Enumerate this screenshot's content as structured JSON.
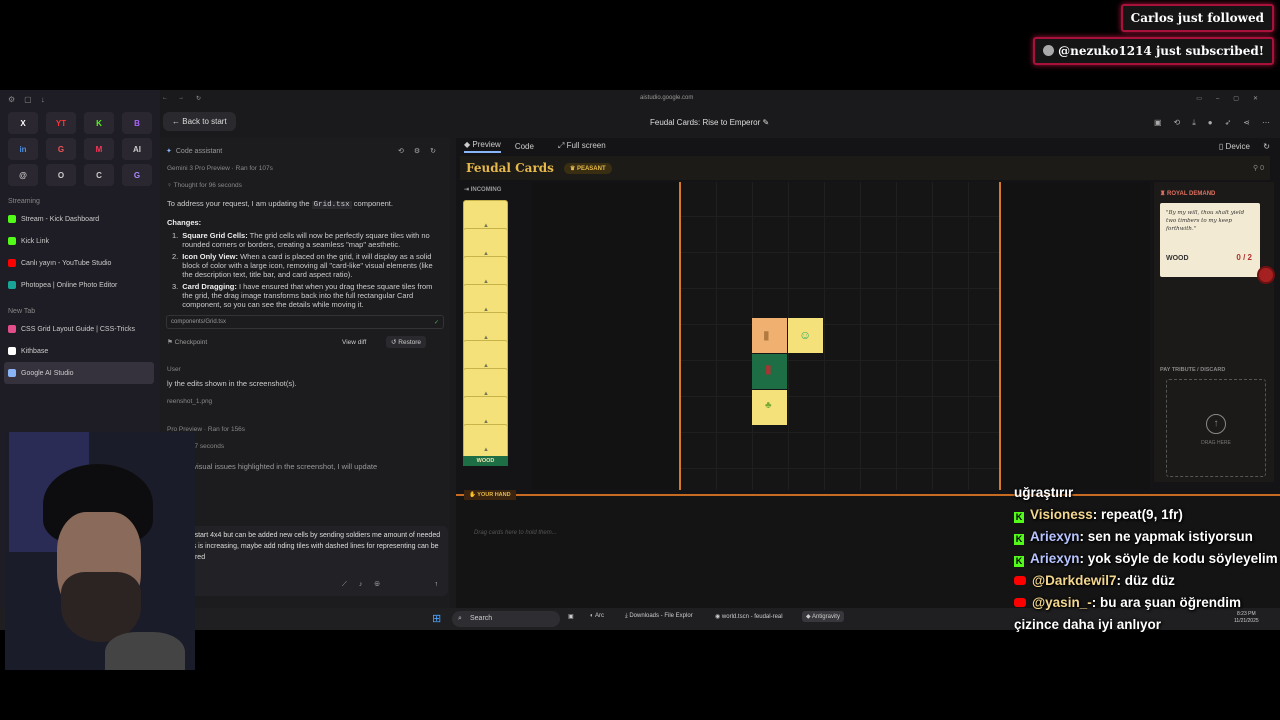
{
  "alerts": {
    "follow": "Carlos just followed",
    "subscribe": "@nezuko1214 just subscribed!"
  },
  "browser": {
    "url": "aistudio.google.com",
    "sidebar": {
      "pinned": [
        "X",
        "YT",
        "K",
        "B",
        "in",
        "G",
        "M",
        "AI",
        "@",
        "O",
        "C",
        "G"
      ],
      "section_streaming": "Streaming",
      "items": [
        {
          "label": "Stream - Kick Dashboard",
          "color": "#53fc18"
        },
        {
          "label": "Kick Link",
          "color": "#53fc18"
        },
        {
          "label": "Canlı yayın - YouTube Studio",
          "color": "#ff0000"
        },
        {
          "label": "Photopea | Online Photo Editor",
          "color": "#18a497"
        }
      ],
      "new_tab": "New Tab",
      "items2": [
        {
          "label": "CSS Grid Layout Guide | CSS-Tricks",
          "color": "#e24e8a"
        },
        {
          "label": "Kithbase",
          "color": "#ffffff"
        },
        {
          "label": "Google AI Studio",
          "color": "#8ab4f8"
        }
      ]
    }
  },
  "app": {
    "back_label": "Back to start",
    "title": "Feudal Cards: Rise to Emperor",
    "code_assistant": "Code assistant",
    "model": "Gemini 3 Pro Preview",
    "ran_for": "Ran for 107s",
    "thought": "Thought for 96 seconds",
    "intro_pre": "To address your request, I am updating the ",
    "intro_code": "Grid.tsx",
    "intro_post": " component.",
    "changes_heading": "Changes:",
    "changes": [
      {
        "n": "1.",
        "title": "Square Grid Cells:",
        "text": " The grid cells will now be perfectly square tiles with no rounded corners or borders, creating a seamless \"map\" aesthetic."
      },
      {
        "n": "2.",
        "title": "Icon Only View:",
        "text": " When a card is placed on the grid, it will display as a solid block of color with a large icon, removing all \"card-like\" visual elements (like the description text, title bar, and card aspect ratio)."
      },
      {
        "n": "3.",
        "title": "Card Dragging:",
        "text": " I have ensured that when you drag these square tiles from the grid, the drag image transforms back into the full rectangular Card component, so you can see the details while moving it."
      }
    ],
    "file": "components/Grid.tsx",
    "checkpoint": "Checkpoint",
    "view_diff": "View diff",
    "restore": "Restore",
    "user_label": "User",
    "user_msg": "ly the edits shown in the screenshot(s).",
    "attachment": "reenshot_1.png",
    "model2": "Pro Preview",
    "ran_for2": "Ran for 156s",
    "thought2": "ught for 97 seconds",
    "partial": "ess the visual issues highlighted in the screenshot, I will update",
    "input_text": "should start 4x4 but can be added new cells by sending soldiers me amount of needed soldiers is increasing, maybe add nding tiles with dashed lines for representing can be conquered"
  },
  "preview": {
    "tabs": [
      "Preview",
      "Code",
      "Full screen"
    ],
    "device": "Device",
    "game_title": "Feudal Cards",
    "rank": "PEASANT",
    "score": "0",
    "incoming": "INCOMING",
    "deck_top_label": "WOOD",
    "royal_demand": "ROYAL DEMAND",
    "demand_quote": "\"By my will, thou shalt yield two timbers to my keep forthwith.\"",
    "demand_resource": "WOOD",
    "demand_count": "0 / 2",
    "tribute": "PAY TRIBUTE / DISCARD",
    "drag_here": "DRAG HERE",
    "your_hand": "YOUR HAND",
    "hand_empty": "Drag cards here to hold them..."
  },
  "taskbar": {
    "search": "Search",
    "apps": [
      "Arc",
      "Downloads - File Explor",
      "world.tscn - feudal-real",
      "Antigravity"
    ],
    "time": "8:23 PM",
    "date": "11/21/2025"
  },
  "chat": [
    {
      "platform": "none",
      "user": "",
      "text": "uğraştırır"
    },
    {
      "platform": "kick",
      "user": "Visioness",
      "text": ": repeat(9, 1fr)"
    },
    {
      "platform": "kick",
      "user": "Ariexyn",
      "text": ": sen ne yapmak istiyorsun"
    },
    {
      "platform": "kick",
      "user": "Ariexyn",
      "text": ": yok söyle de kodu söyleyelim"
    },
    {
      "platform": "yt",
      "user": "@Darkdewil7",
      "text": ": düz düz"
    },
    {
      "platform": "yt",
      "user": "@yasin_-",
      "text": ": bu ara şuan öğrendim çizince daha iyi anlıyor"
    }
  ]
}
